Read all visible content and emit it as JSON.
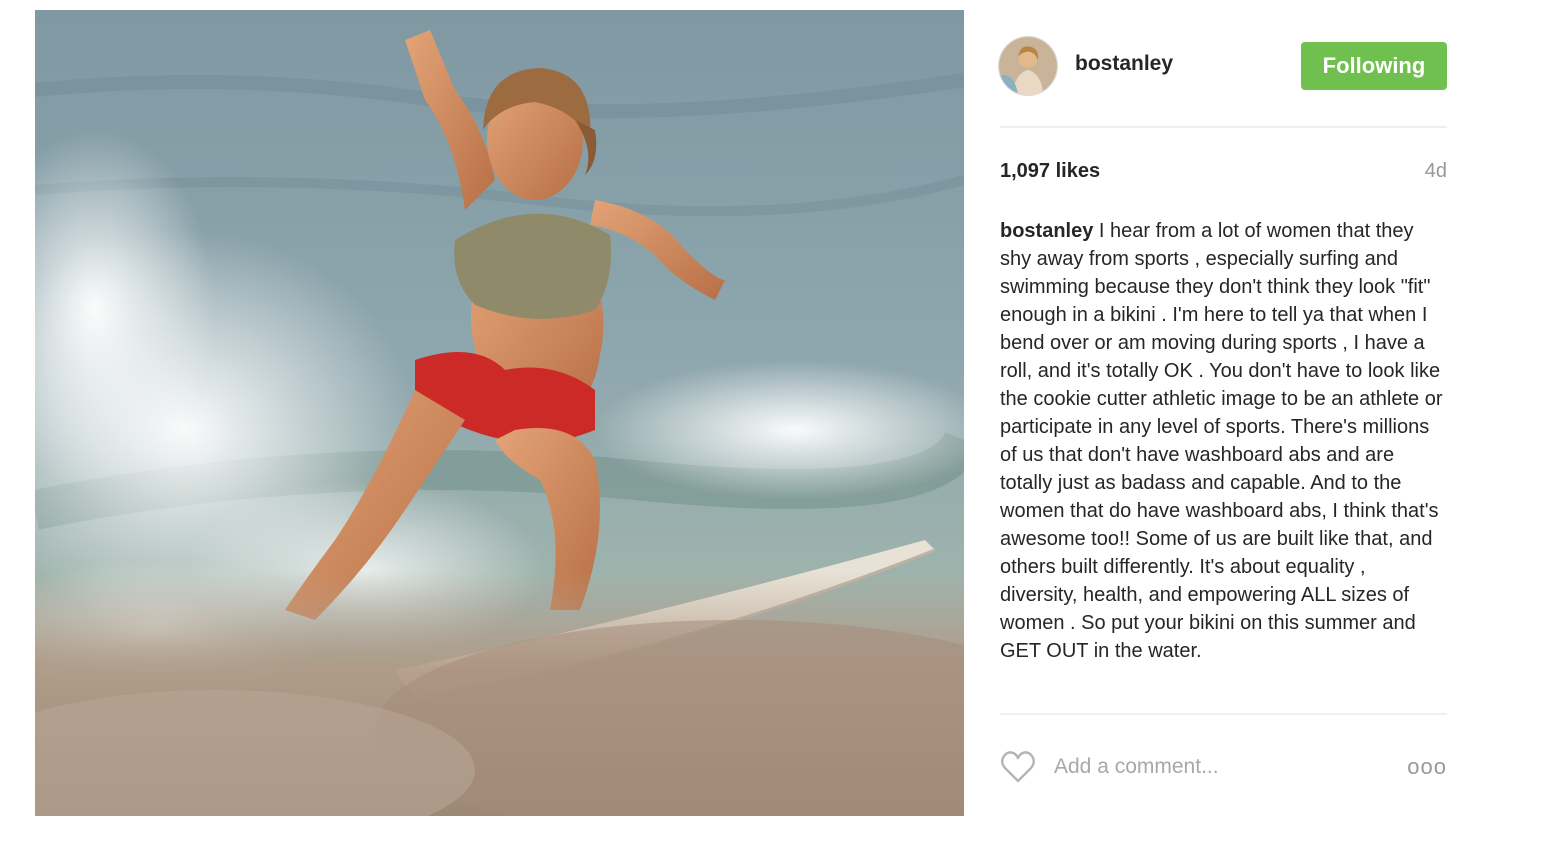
{
  "post": {
    "photo_description_icon": "surfer-photo",
    "header": {
      "avatar_icon": "profile-avatar",
      "username": "bostanley",
      "follow_button_label": "Following"
    },
    "likes": "1,097 likes",
    "time_ago": "4d",
    "caption": {
      "username": "bostanley",
      "text": "I hear from a lot of women that they shy away from sports , especially surfing and swimming because they don't think they look \"fit\" enough in a bikini . I'm here to tell ya that when I bend over or am moving during sports , I have a roll, and it's totally OK . You don't have to look like the cookie cutter athletic image to be an athlete or participate in any level of sports. There's millions of us that don't have washboard abs and are totally just as badass and capable. And to the women that do have washboard abs, I think that's awesome too!! Some of us are built like that, and others built differently. It's about equality , diversity, health, and empowering ALL sizes of women . So put your bikini on this summer and GET OUT in the water."
    },
    "footer": {
      "like_icon": "heart-icon",
      "comment_placeholder": "Add a comment...",
      "more_icon": "more-options-icon",
      "more_glyph": "ooo"
    },
    "colors": {
      "follow_button": "#70c050",
      "text": "#262626",
      "muted": "#999999"
    }
  }
}
